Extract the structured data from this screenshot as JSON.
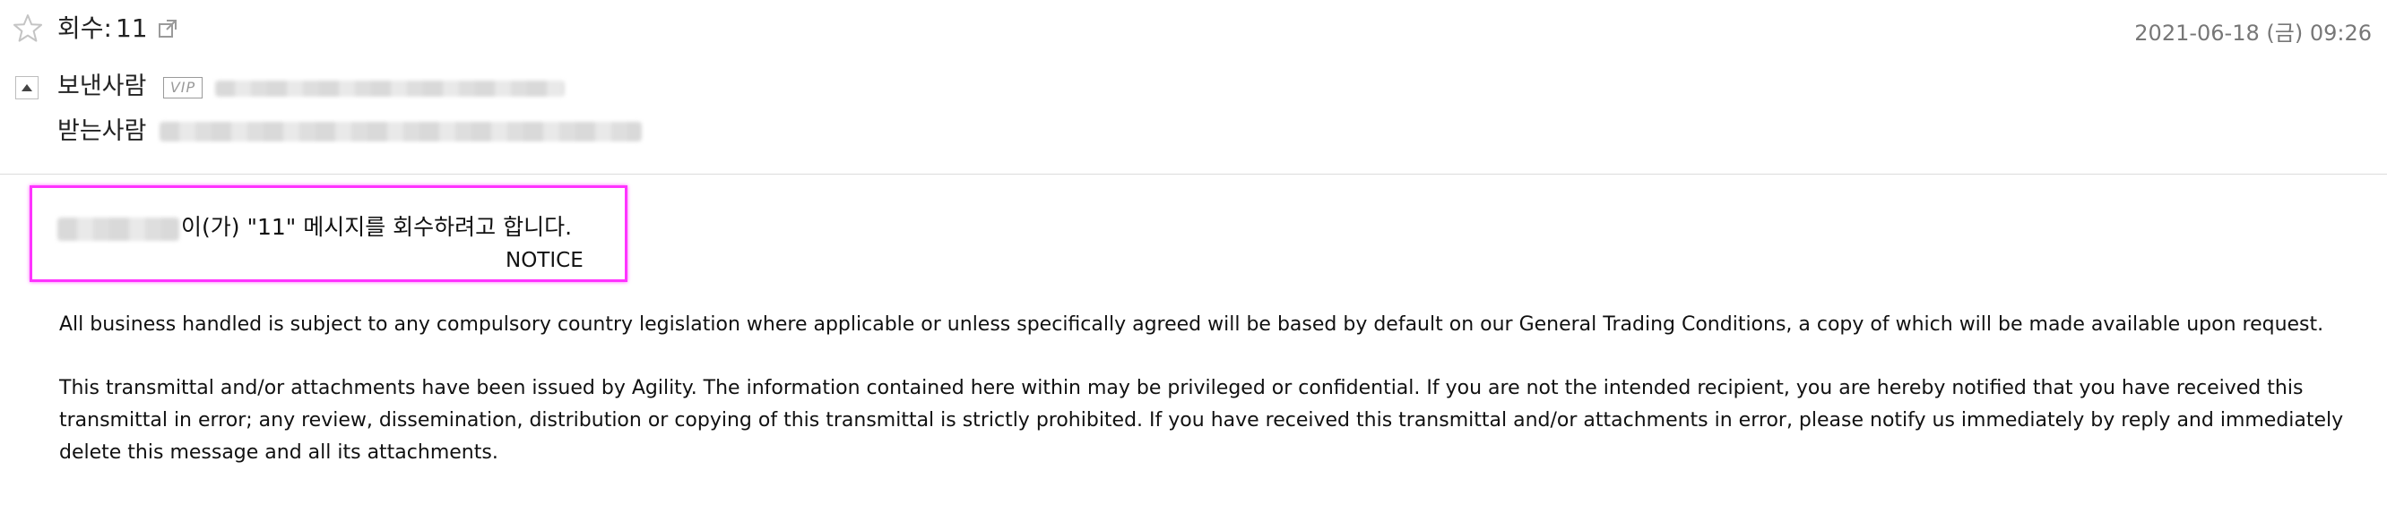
{
  "header": {
    "subject_label": "회수:",
    "subject_value": "11",
    "date": "2021-06-18 (금) 09:26"
  },
  "recipients": {
    "from_label": "보낸사람",
    "vip_badge": "VIP",
    "to_label": "받는사람"
  },
  "notice": {
    "recall_message": "이(가) \"11\" 메시지를 회수하려고 합니다.",
    "notice_label": "NOTICE"
  },
  "body": {
    "paragraph_1": "All business handled is subject to any compulsory country legislation where applicable or unless specifically agreed will be based by default on our General Trading Conditions, a copy of which will be made available upon request.",
    "paragraph_2": "This transmittal and/or attachments have been issued by Agility. The information contained here within may be privileged or confidential. If you are not the intended recipient, you are hereby notified that you have received this transmittal in error; any review, dissemination, distribution or copying of this transmittal is strictly prohibited. If you have received this transmittal and/or attachments in error, please notify us immediately by reply and immediately delete this message and all its attachments."
  },
  "icons": {
    "star": "star-outline-icon",
    "external": "external-link-icon",
    "collapse": "collapse-up-icon"
  },
  "colors": {
    "highlight": "#ff33ff",
    "date_text": "#777777",
    "divider": "#dcdcdc"
  }
}
